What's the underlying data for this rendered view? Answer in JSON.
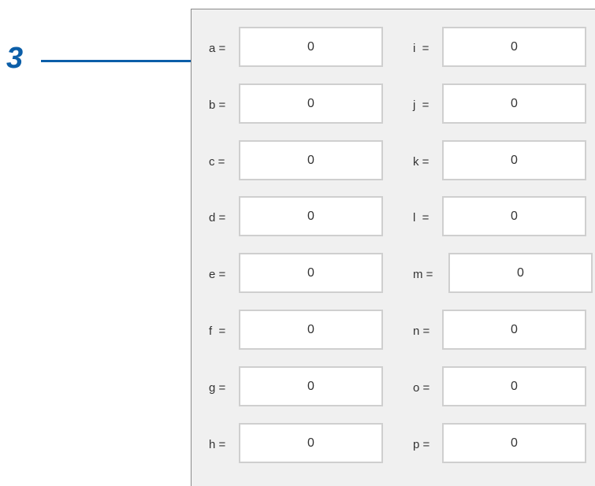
{
  "callout": {
    "number": "3"
  },
  "left_column": [
    {
      "label": "a =",
      "value": "0"
    },
    {
      "label": "b =",
      "value": "0"
    },
    {
      "label": "c =",
      "value": "0"
    },
    {
      "label": "d =",
      "value": "0"
    },
    {
      "label": "e =",
      "value": "0"
    },
    {
      "label": "f  =",
      "value": "0"
    },
    {
      "label": "g =",
      "value": "0"
    },
    {
      "label": "h =",
      "value": "0"
    }
  ],
  "right_column": [
    {
      "label": "i  =",
      "value": "0"
    },
    {
      "label": "j  =",
      "value": "0"
    },
    {
      "label": "k =",
      "value": "0"
    },
    {
      "label": "l  =",
      "value": "0"
    },
    {
      "label": "m =",
      "value": "0"
    },
    {
      "label": "n =",
      "value": "0"
    },
    {
      "label": "o =",
      "value": "0"
    },
    {
      "label": "p =",
      "value": "0"
    }
  ],
  "colors": {
    "callout": "#0b5ea8",
    "panel_bg": "#f0f0f0",
    "field_border": "#cfcfcf"
  }
}
